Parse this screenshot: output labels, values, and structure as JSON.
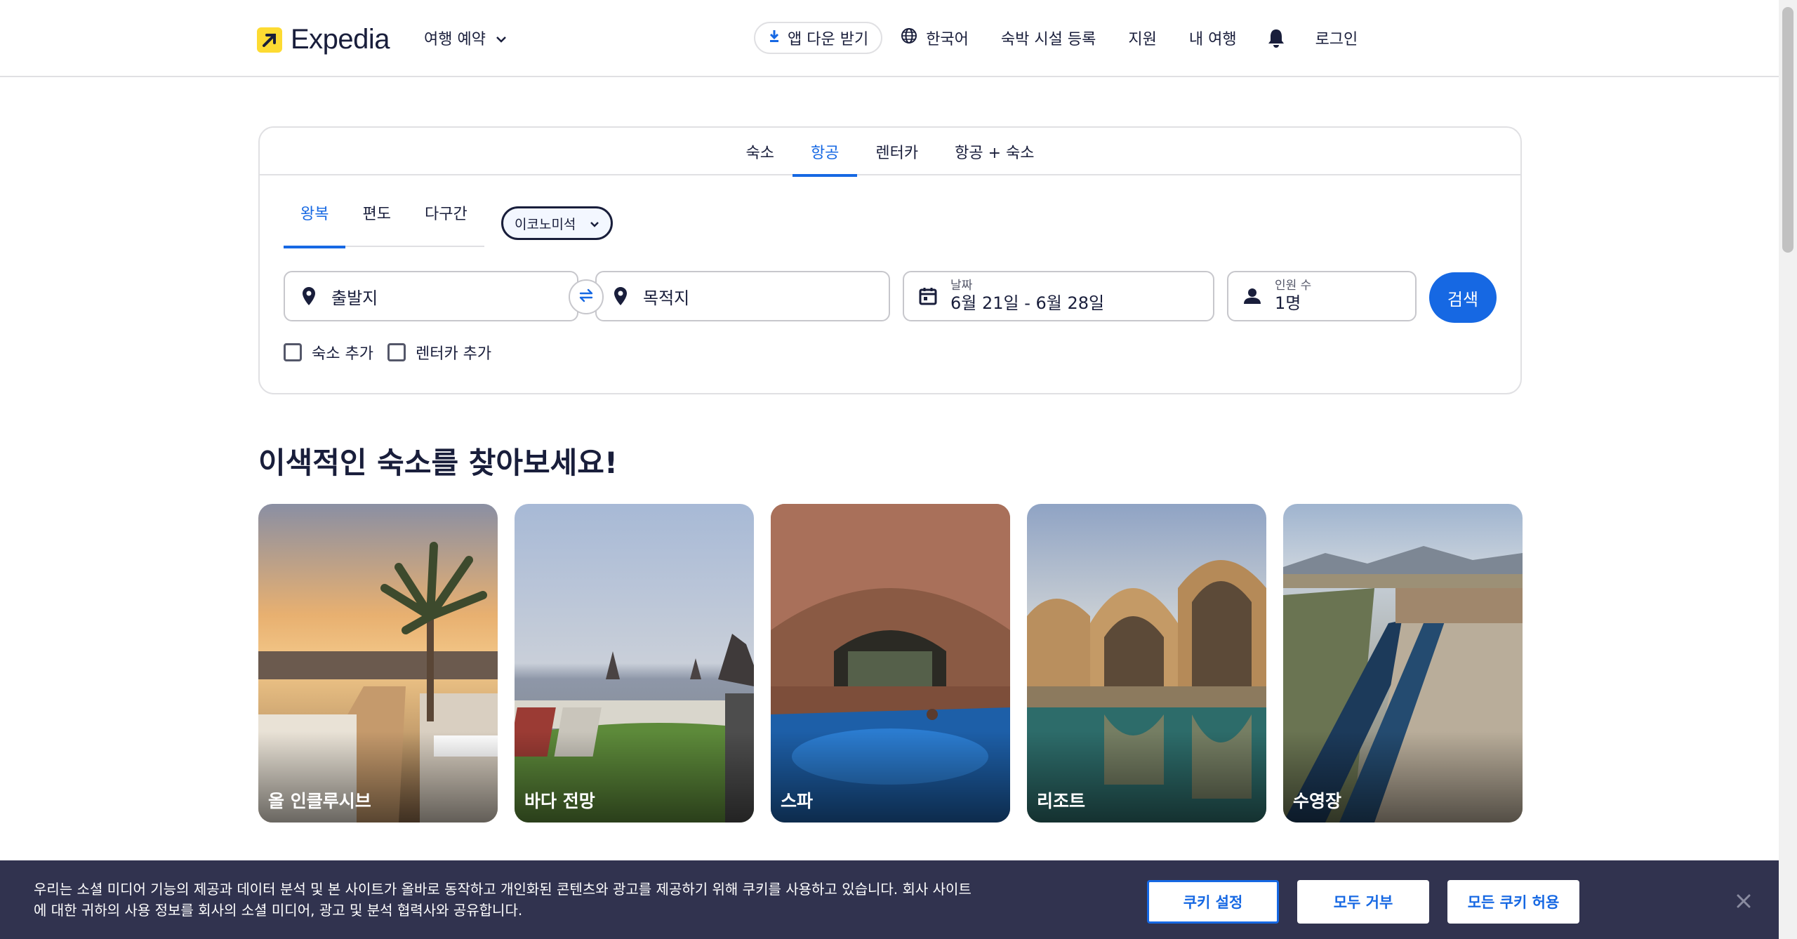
{
  "header": {
    "brand": "Expedia",
    "trip_menu": "여행 예약",
    "app_button": "앱 다운 받기",
    "language": "한국어",
    "list_property": "숙박 시설 등록",
    "support": "지원",
    "my_trips": "내 여행",
    "login": "로그인"
  },
  "search": {
    "tabs": [
      "숙소",
      "항공",
      "렌터카",
      "항공 + 숙소"
    ],
    "active_tab": "항공",
    "trip_types": [
      "왕복",
      "편도",
      "다구간"
    ],
    "active_trip_type": "왕복",
    "cabin_class": "이코노미석",
    "origin_placeholder": "출발지",
    "destination_placeholder": "목적지",
    "dates_label": "날짜",
    "dates_value": "6월 21일 - 6월 28일",
    "travelers_label": "인원 수",
    "travelers_value": "1명",
    "search_button": "검색",
    "addons": [
      "숙소 추가",
      "렌터카 추가"
    ]
  },
  "section": {
    "title": "이색적인 숙소를 찾아보세요!",
    "cards": [
      "올 인클루시브",
      "바다 전망",
      "스파",
      "리조트",
      "수영장"
    ]
  },
  "cookie_banner": {
    "text": "우리는 소셜 미디어 기능의 제공과 데이터 분석 및 본 사이트가 올바로 동작하고 개인화된 콘텐츠와 광고를 제공하기 위해 쿠키를 사용하고 있습니다. 회사 사이트에 대한 귀하의 사용 정보를 회사의 소셜 미디어, 광고 및 분석 협력사와 공유합니다.",
    "settings_button": "쿠키 설정",
    "reject_button": "모두 거부",
    "accept_button": "모든 쿠키 허용"
  },
  "colors": {
    "accent": "#1668e3",
    "brand_yellow": "#fddb32",
    "text": "#191e3b",
    "banner": "#31334f"
  }
}
